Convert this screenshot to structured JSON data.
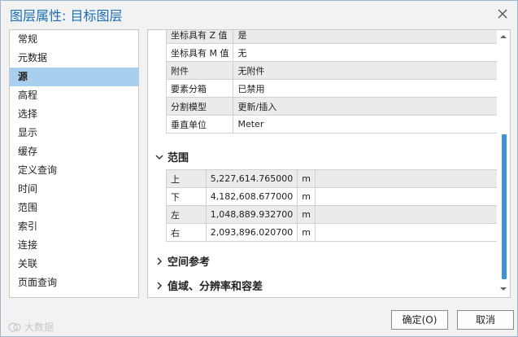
{
  "window": {
    "title": "图层属性: 目标图层"
  },
  "nav": {
    "items": [
      {
        "label": "常规"
      },
      {
        "label": "元数据"
      },
      {
        "label": "源",
        "selected": true
      },
      {
        "label": "高程"
      },
      {
        "label": "选择"
      },
      {
        "label": "显示"
      },
      {
        "label": "缓存"
      },
      {
        "label": "定义查询"
      },
      {
        "label": "时间"
      },
      {
        "label": "范围"
      },
      {
        "label": "索引"
      },
      {
        "label": "连接"
      },
      {
        "label": "关联"
      },
      {
        "label": "页面查询"
      }
    ]
  },
  "props_table": {
    "rows": [
      {
        "key": "坐标具有 Z 值",
        "value": "是"
      },
      {
        "key": "坐标具有 M 值",
        "value": "无"
      },
      {
        "key": "附件",
        "value": "无附件"
      },
      {
        "key": "要素分箱",
        "value": "已禁用"
      },
      {
        "key": "分割模型",
        "value": "更新/插入"
      },
      {
        "key": "垂直单位",
        "value": "Meter"
      }
    ]
  },
  "extent_section": {
    "title": "范围",
    "rows": [
      {
        "dir": "上",
        "value": "5,227,614.765000",
        "unit": "m"
      },
      {
        "dir": "下",
        "value": "4,182,608.677000",
        "unit": "m"
      },
      {
        "dir": "左",
        "value": "1,048,889.932700",
        "unit": "m"
      },
      {
        "dir": "右",
        "value": "2,093,896.020700",
        "unit": "m"
      }
    ]
  },
  "spatial_ref_section": {
    "title": "空间参考"
  },
  "domain_section": {
    "title": "值域、分辨率和容差"
  },
  "buttons": {
    "ok": "确定(O)",
    "cancel": "取消"
  },
  "watermark": {
    "text": "大数据"
  },
  "colors": {
    "title": "#1a6fb4",
    "selected": "#a9cfee",
    "scroll_thumb": "#3e92d8"
  }
}
